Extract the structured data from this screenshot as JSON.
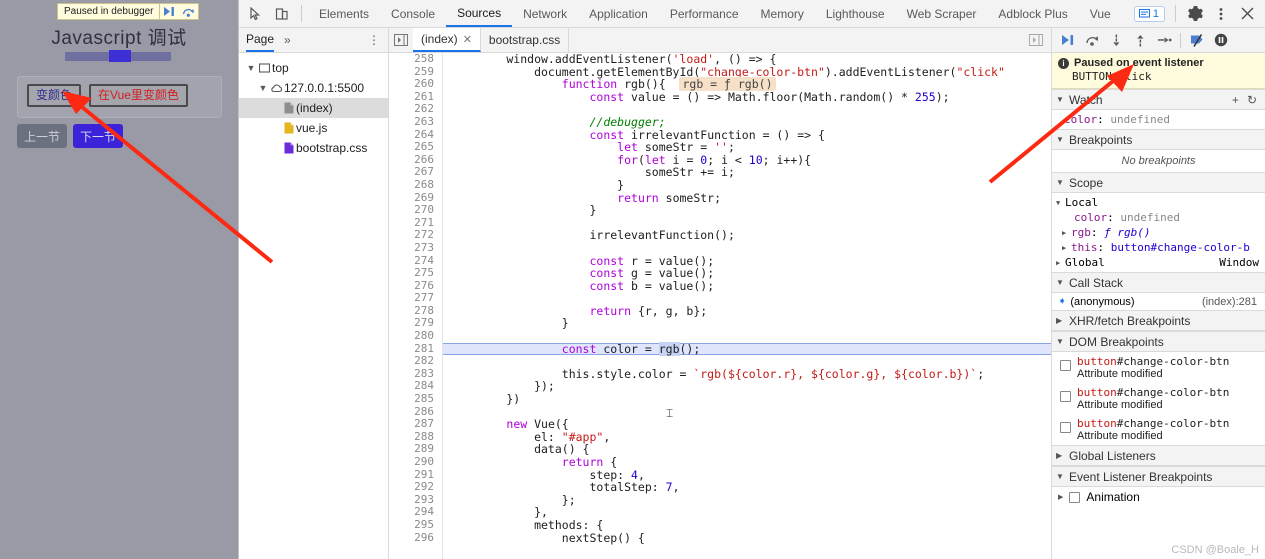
{
  "page": {
    "paused_banner": {
      "text": "Paused in debugger",
      "resume_icon": "resume-icon",
      "step-over_icon": "step-over-icon"
    },
    "title": "Javascript 调试",
    "buttons": {
      "change_color": "变颜色",
      "change_color_vue": "在Vue里变颜色"
    },
    "steps": {
      "prev": "上一节",
      "next": "下一节"
    }
  },
  "devtools": {
    "tabs": [
      {
        "label": "Elements",
        "active": false
      },
      {
        "label": "Console",
        "active": false
      },
      {
        "label": "Sources",
        "active": true
      },
      {
        "label": "Network",
        "active": false
      },
      {
        "label": "Application",
        "active": false
      },
      {
        "label": "Performance",
        "active": false
      },
      {
        "label": "Memory",
        "active": false
      },
      {
        "label": "Lighthouse",
        "active": false
      },
      {
        "label": "Web Scraper",
        "active": false
      },
      {
        "label": "Adblock Plus",
        "active": false
      },
      {
        "label": "Vue",
        "active": false
      }
    ],
    "message_badge": "1",
    "icons": {
      "inspect": "inspect-element-icon",
      "device": "device-toolbar-icon",
      "settings": "gear-icon",
      "more": "kebab-menu-icon",
      "close": "close-icon"
    },
    "navigator": {
      "tab": "Page",
      "overflow": "»",
      "more": "⋮",
      "tree": [
        {
          "label": "top",
          "depth": 0,
          "icon": "frame-icon",
          "expanded": true,
          "selected": false
        },
        {
          "label": "127.0.0.1:5500",
          "depth": 1,
          "icon": "cloud-icon",
          "expanded": true,
          "selected": false
        },
        {
          "label": "(index)",
          "depth": 2,
          "icon": "document-icon",
          "expanded": null,
          "selected": true
        },
        {
          "label": "vue.js",
          "depth": 2,
          "icon": "js-file-icon",
          "expanded": null,
          "selected": false
        },
        {
          "label": "bootstrap.css",
          "depth": 2,
          "icon": "css-file-icon",
          "expanded": null,
          "selected": false
        }
      ]
    },
    "editor": {
      "tabs": [
        {
          "label": "(index)",
          "active": true,
          "closable": true
        },
        {
          "label": "bootstrap.css",
          "active": false,
          "closable": false
        }
      ],
      "first_line": 258,
      "highlighted_line": 281,
      "inline_hint": "rgb = ƒ rgb()",
      "lines": [
        "        window.addEventListener('load', () => {",
        "            document.getElementById(\"change-color-btn\").addEventListener(\"click\"",
        "                function rgb(){",
        "                    const value = () => Math.floor(Math.random() * 255);",
        "",
        "                    //debugger;",
        "                    const irrelevantFunction = () => {",
        "                        let someStr = '';",
        "                        for(let i = 0; i < 10; i++){",
        "                            someStr += i;",
        "                        }",
        "                        return someStr;",
        "                    }",
        "",
        "                    irrelevantFunction();",
        "",
        "                    const r = value();",
        "                    const g = value();",
        "                    const b = value();",
        "",
        "                    return {r, g, b};",
        "                }",
        "",
        "                const color = rgb();",
        "",
        "                this.style.color = `rgb(${color.r}, ${color.g}, ${color.b})`;",
        "            });",
        "        })",
        "",
        "        new Vue({",
        "            el: \"#app\",",
        "            data() {",
        "                return {",
        "                    step: 4,",
        "                    totalStep: 7,",
        "                };",
        "            },",
        "            methods: {",
        "                nextStep() {"
      ]
    },
    "debugger": {
      "controls": [
        {
          "name": "resume-script-icon",
          "glyph": "▶|"
        },
        {
          "name": "step-over-icon",
          "glyph": "↷"
        },
        {
          "name": "step-into-icon",
          "glyph": "↓"
        },
        {
          "name": "step-out-icon",
          "glyph": "↑"
        },
        {
          "name": "step-icon",
          "glyph": "→·"
        },
        {
          "name": "deactivate-breakpoints-icon",
          "glyph": "⦸"
        },
        {
          "name": "pause-on-exceptions-icon",
          "glyph": "⏸"
        }
      ],
      "paused_on": {
        "title": "Paused on event listener",
        "detail": "BUTTON.click"
      },
      "watch": {
        "title": "Watch",
        "add": "+",
        "refresh": "↻",
        "items": [
          {
            "name": "color",
            "value": "undefined"
          }
        ]
      },
      "breakpoints": {
        "title": "Breakpoints",
        "empty": "No breakpoints"
      },
      "scope": {
        "title": "Scope",
        "groups": [
          {
            "name": "Local",
            "expanded": true,
            "items": [
              {
                "name": "color",
                "value": "undefined",
                "expandable": false
              },
              {
                "name": "rgb",
                "value": "ƒ rgb()",
                "expandable": true
              },
              {
                "name": "this",
                "value": "button#change-color-b",
                "expandable": true
              }
            ]
          },
          {
            "name": "Global",
            "expanded": false,
            "value": "Window",
            "items": []
          }
        ]
      },
      "call_stack": {
        "title": "Call Stack",
        "frames": [
          {
            "name": "(anonymous)",
            "location": "(index):281",
            "current": true
          }
        ]
      },
      "xhr_breakpoints": {
        "title": "XHR/fetch Breakpoints"
      },
      "dom_breakpoints": {
        "title": "DOM Breakpoints",
        "items": [
          {
            "tag": "button",
            "id": "#change-color-btn",
            "desc": "Attribute modified",
            "checked": false
          },
          {
            "tag": "button",
            "id": "#change-color-btn",
            "desc": "Attribute modified",
            "checked": false
          },
          {
            "tag": "button",
            "id": "#change-color-btn",
            "desc": "Attribute modified",
            "checked": false
          }
        ]
      },
      "global_listeners": {
        "title": "Global Listeners"
      },
      "event_listener_breakpoints": {
        "title": "Event Listener Breakpoints",
        "items": [
          {
            "label": "Animation",
            "checked": false
          }
        ]
      }
    }
  },
  "watermark": "CSDN @Boale_H",
  "colors": {
    "accent": "#1a73e8",
    "paused_bg": "#fffbdd",
    "highlight": "#dfe6fb",
    "arrow": "#fc2a12"
  }
}
